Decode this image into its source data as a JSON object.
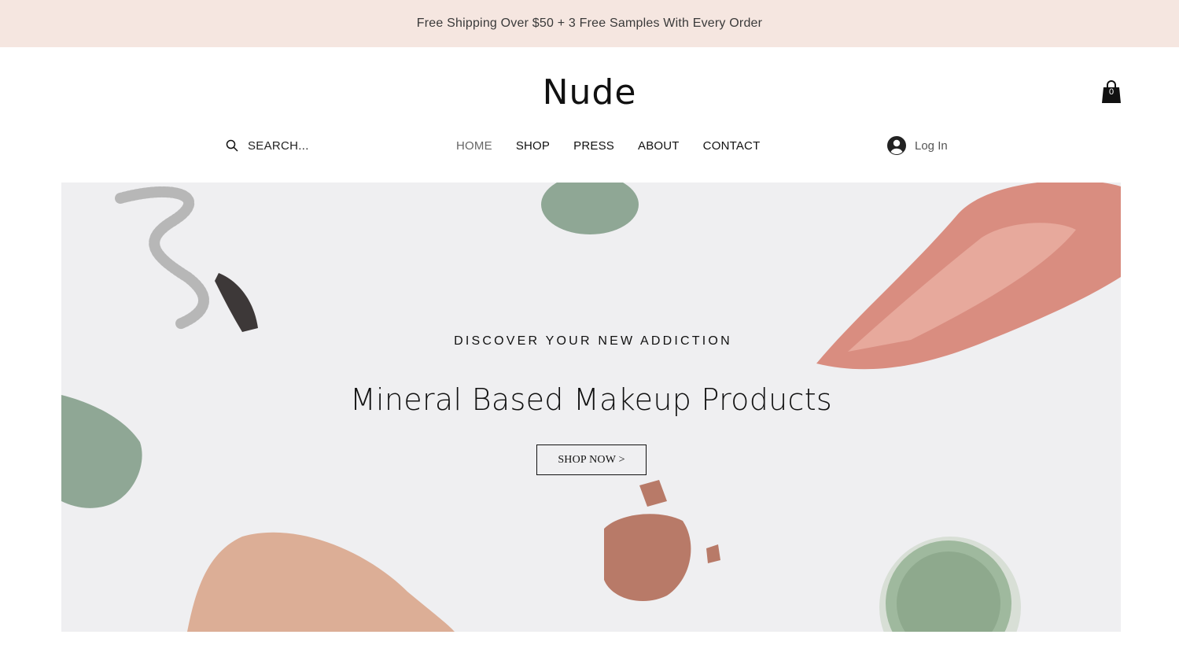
{
  "promo": {
    "text": "Free Shipping Over $50 + 3 Free Samples With Every Order"
  },
  "header": {
    "logo": "Nude",
    "cart_count": "0",
    "search_placeholder": "SEARCH...",
    "login_label": "Log In"
  },
  "nav": {
    "items": [
      {
        "label": "HOME",
        "active": true
      },
      {
        "label": "SHOP"
      },
      {
        "label": "PRESS"
      },
      {
        "label": "ABOUT"
      },
      {
        "label": "CONTACT"
      }
    ]
  },
  "hero": {
    "eyebrow": "DISCOVER YOUR NEW ADDICTION",
    "title": "Mineral Based Makeup Products",
    "cta_label": "SHOP NOW >"
  },
  "colors": {
    "promo_bg": "#f5e6e0",
    "hero_bg": "#efeff1",
    "blush": "#d98d80",
    "green_powder": "#7e9a85",
    "foundation": "#dcae96",
    "bronze": "#b87a68",
    "compact": "#9fb99e"
  },
  "icons": [
    "search-icon",
    "user-avatar-icon",
    "shopping-bag-icon"
  ]
}
